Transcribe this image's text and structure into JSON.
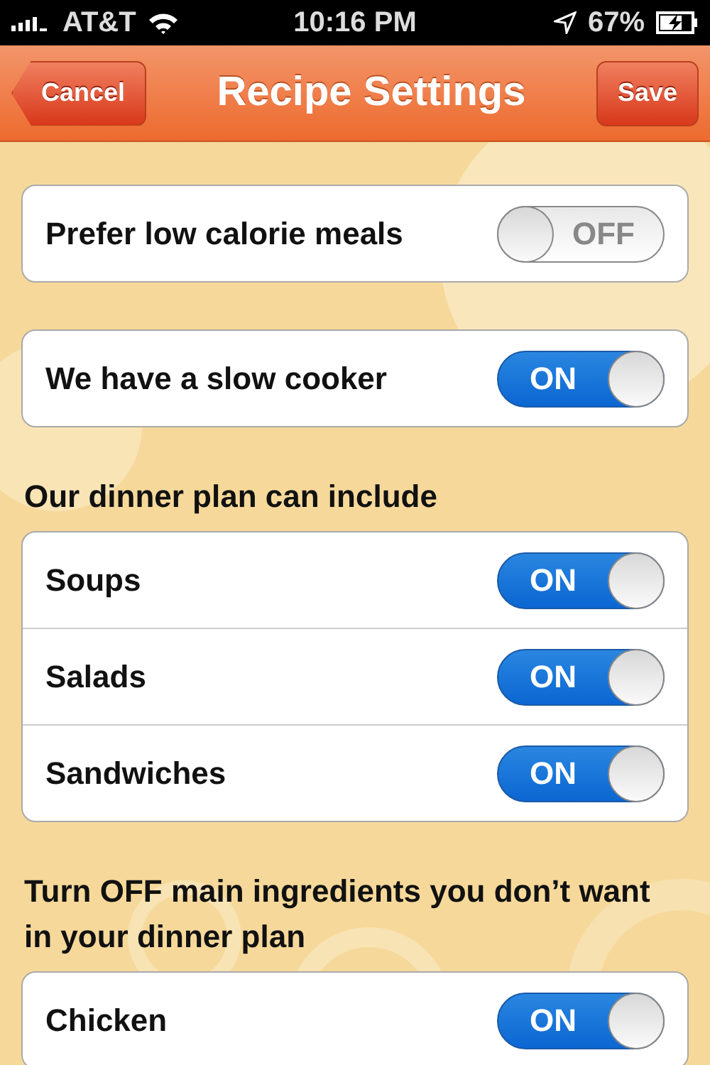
{
  "status_bar": {
    "carrier": "AT&T",
    "time": "10:16 PM",
    "battery": "67%"
  },
  "nav": {
    "left_button": "Cancel",
    "title": "Recipe Settings",
    "right_button": "Save"
  },
  "sections": [
    {
      "rows": [
        {
          "label": "Prefer low calorie meals",
          "on": false,
          "switch_label": "OFF"
        }
      ]
    },
    {
      "rows": [
        {
          "label": "We have a slow cooker",
          "on": true,
          "switch_label": "ON"
        }
      ]
    },
    {
      "header": "Our dinner plan can include",
      "rows": [
        {
          "label": "Soups",
          "on": true,
          "switch_label": "ON"
        },
        {
          "label": "Salads",
          "on": true,
          "switch_label": "ON"
        },
        {
          "label": "Sandwiches",
          "on": true,
          "switch_label": "ON"
        }
      ]
    },
    {
      "header": "Turn OFF main ingredients you don’t want in your dinner plan",
      "rows": [
        {
          "label": "Chicken",
          "on": true,
          "switch_label": "ON"
        }
      ]
    }
  ]
}
